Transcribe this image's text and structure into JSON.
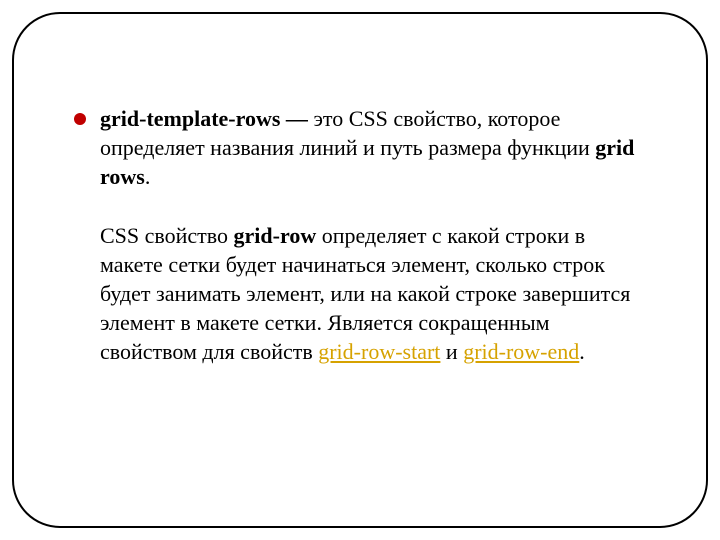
{
  "bullet": {
    "p1_bold1": "grid-template-rows — ",
    "p1_rest": "это CSS свойство, которое определяет названия линий и путь размера функции ",
    "p1_bold2": "grid rows",
    "p1_period": ".",
    "p2_pre": "CSS свойство ",
    "p2_bold": "grid-row",
    "p2_rest1": " определяет с какой строки в макете сетки будет начинаться элемент, сколько строк будет занимать элемент, или на какой строке завершится элемент в макете сетки. Является сокращенным свойством для свойств ",
    "p2_link1": "grid-row-start",
    "p2_and": " и ",
    "p2_link2": "grid-row-end",
    "p2_period": "."
  }
}
